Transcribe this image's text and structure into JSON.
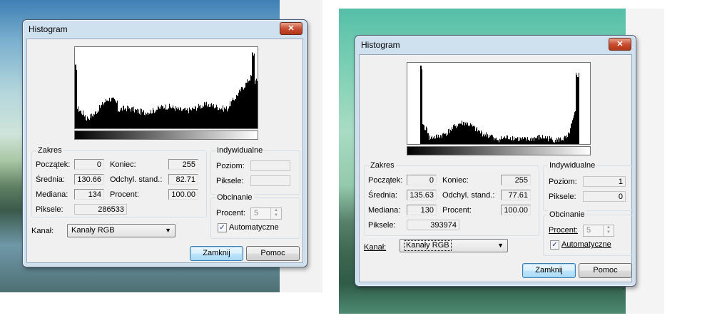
{
  "dialogs": [
    {
      "title": "Histogram",
      "close_label": "✕",
      "range_group": "Zakres",
      "start_label": "Początek:",
      "start_value": "0",
      "end_label": "Koniec:",
      "end_value": "255",
      "mean_label": "Średnia:",
      "mean_value": "130.66",
      "stddev_label": "Odchyl. stand.:",
      "stddev_value": "82.71",
      "median_label": "Mediana:",
      "median_value": "134",
      "percent_label": "Procent:",
      "percent_value": "100.00",
      "pixels_label": "Piksele:",
      "pixels_value": "286533",
      "individual_group": "Indywidualne",
      "level_label": "Poziom:",
      "level_value": "",
      "ind_pixels_label": "Piksele:",
      "ind_pixels_value": "",
      "clip_group": "Obcinanie",
      "clip_percent_label": "Procent:",
      "clip_percent_value": "5",
      "auto_label": "Automatyczne",
      "auto_checked": true,
      "channel_label": "Kanał:",
      "channel_value": "Kanały RGB",
      "close_button": "Zamknij",
      "help_button": "Pomoc"
    },
    {
      "title": "Histogram",
      "close_label": "✕",
      "range_group": "Zakres",
      "start_label": "Początek:",
      "start_value": "0",
      "end_label": "Koniec:",
      "end_value": "255",
      "mean_label": "Średnia:",
      "mean_value": "135.63",
      "stddev_label": "Odchyl. stand.:",
      "stddev_value": "77.61",
      "median_label": "Mediana:",
      "median_value": "130",
      "percent_label": "Procent:",
      "percent_value": "100.00",
      "pixels_label": "Piksele:",
      "pixels_value": "393974",
      "individual_group": "Indywidualne",
      "level_label": "Poziom:",
      "level_value": "1",
      "ind_pixels_label": "Piksele:",
      "ind_pixels_value": "0",
      "clip_group": "Obcinanie",
      "clip_percent_label": "Procent:",
      "clip_percent_value": "5",
      "auto_label": "Automatyczne",
      "auto_checked": true,
      "channel_label": "Kanał:",
      "channel_value": "Kanały RGB",
      "close_button": "Zamknij",
      "help_button": "Pomoc"
    }
  ]
}
